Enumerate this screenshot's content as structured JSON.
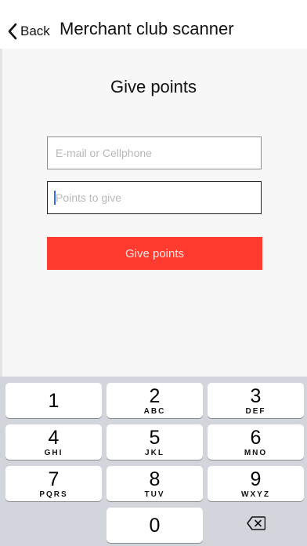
{
  "nav": {
    "back_label": "Back",
    "title": "Merchant club scanner"
  },
  "form": {
    "heading": "Give points",
    "email_placeholder": "E-mail or Cellphone",
    "email_value": "",
    "points_placeholder": "Points to give",
    "points_value": "",
    "submit_label": "Give points"
  },
  "keyboard": {
    "keys": [
      {
        "digit": "1",
        "letters": ""
      },
      {
        "digit": "2",
        "letters": "ABC"
      },
      {
        "digit": "3",
        "letters": "DEF"
      },
      {
        "digit": "4",
        "letters": "GHI"
      },
      {
        "digit": "5",
        "letters": "JKL"
      },
      {
        "digit": "6",
        "letters": "MNO"
      },
      {
        "digit": "7",
        "letters": "PQRS"
      },
      {
        "digit": "8",
        "letters": "TUV"
      },
      {
        "digit": "9",
        "letters": "WXYZ"
      },
      {
        "digit": "0",
        "letters": ""
      }
    ],
    "delete_icon": "backspace-icon"
  },
  "colors": {
    "accent": "#ff3b2f",
    "keyboard_bg": "#d2d5db",
    "caret": "#2f6fe4"
  }
}
